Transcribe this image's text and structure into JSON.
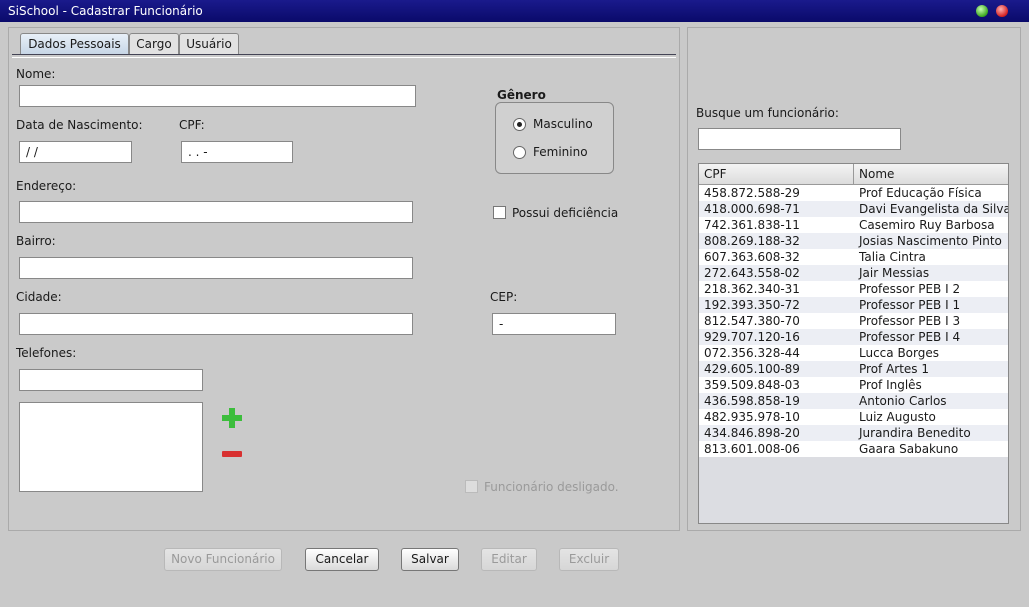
{
  "window": {
    "title": "SiSchool - Cadastrar Funcionário"
  },
  "tabs": [
    {
      "label": "Dados Pessoais",
      "active": true
    },
    {
      "label": "Cargo",
      "active": false
    },
    {
      "label": "Usuário",
      "active": false
    }
  ],
  "form": {
    "nome_label": "Nome:",
    "nome_value": "",
    "nascimento_label": "Data de Nascimento:",
    "nascimento_value": " /  /",
    "cpf_label": "CPF:",
    "cpf_value": "   .   .   -",
    "endereco_label": "Endereço:",
    "endereco_value": "",
    "bairro_label": "Bairro:",
    "bairro_value": "",
    "cidade_label": "Cidade:",
    "cidade_value": "",
    "cep_label": "CEP:",
    "cep_value": "     -",
    "telefones_label": "Telefones:",
    "telefone_value": "",
    "genero_label": "Gênero",
    "genero_options": [
      {
        "label": "Masculino",
        "selected": true
      },
      {
        "label": "Feminino",
        "selected": false
      }
    ],
    "deficiencia_label": "Possui deficiência",
    "deficiencia_checked": false,
    "desligado_label": "Funcionário desligado.",
    "desligado_enabled": false
  },
  "icons": {
    "add": "plus-icon",
    "remove": "minus-icon"
  },
  "colors": {
    "titlebar": "#0e0e78",
    "add": "#3cbd3c",
    "remove": "#d83030"
  },
  "search": {
    "label": "Busque um funcionário:",
    "value": "",
    "columns": [
      "CPF",
      "Nome"
    ],
    "rows": [
      [
        "458.872.588-29",
        "Prof Educação Física"
      ],
      [
        "418.000.698-71",
        "Davi Evangelista da Silva"
      ],
      [
        "742.361.838-11",
        "Casemiro Ruy Barbosa"
      ],
      [
        "808.269.188-32",
        "Josias Nascimento Pinto"
      ],
      [
        "607.363.608-32",
        "Talia Cintra"
      ],
      [
        "272.643.558-02",
        "Jair Messias"
      ],
      [
        "218.362.340-31",
        "Professor PEB I 2"
      ],
      [
        "192.393.350-72",
        "Professor PEB I 1"
      ],
      [
        "812.547.380-70",
        "Professor PEB I 3"
      ],
      [
        "929.707.120-16",
        "Professor PEB I 4"
      ],
      [
        "072.356.328-44",
        "Lucca Borges"
      ],
      [
        "429.605.100-89",
        "Prof Artes 1"
      ],
      [
        "359.509.848-03",
        "Prof Inglês"
      ],
      [
        "436.598.858-19",
        "Antonio Carlos"
      ],
      [
        "482.935.978-10",
        "Luiz Augusto"
      ],
      [
        "434.846.898-20",
        "Jurandira Benedito"
      ],
      [
        "813.601.008-06",
        "Gaara Sabakuno"
      ]
    ]
  },
  "buttons": {
    "novo": {
      "label": "Novo Funcionário",
      "enabled": false
    },
    "cancelar": {
      "label": "Cancelar",
      "enabled": true
    },
    "salvar": {
      "label": "Salvar",
      "enabled": true
    },
    "editar": {
      "label": "Editar",
      "enabled": false
    },
    "excluir": {
      "label": "Excluir",
      "enabled": false
    }
  }
}
